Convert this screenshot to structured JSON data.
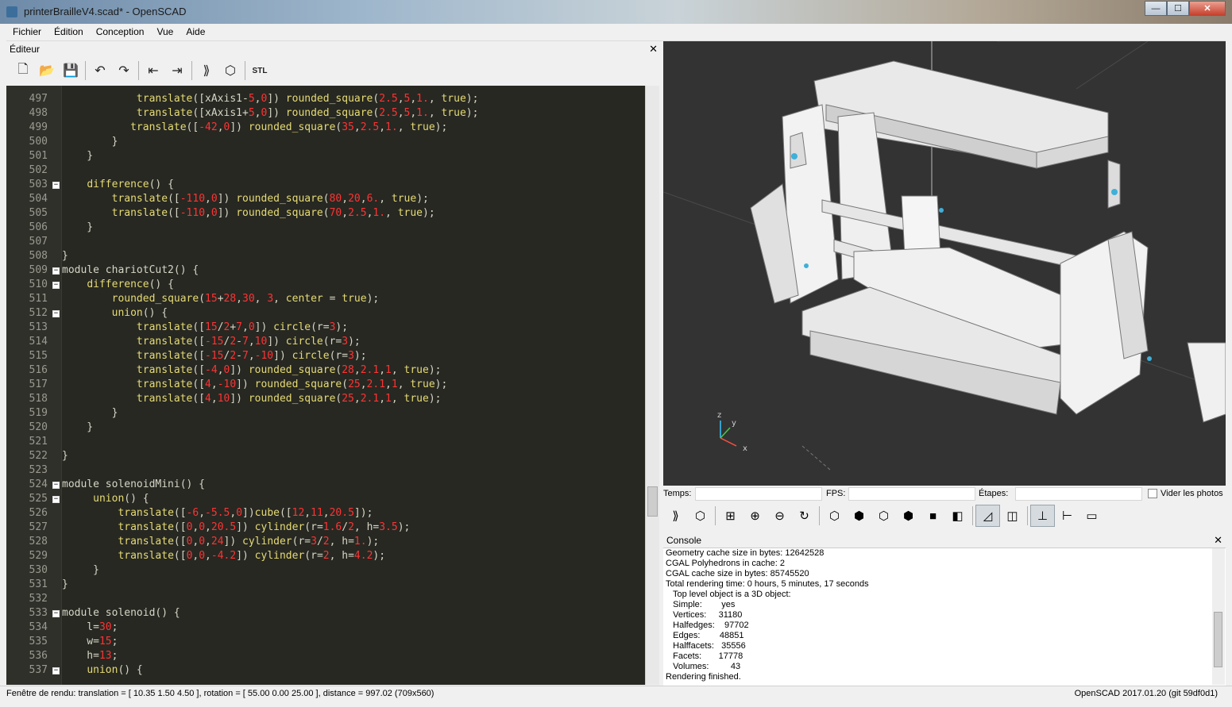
{
  "window": {
    "title": "printerBrailleV4.scad* - OpenSCAD",
    "min": "—",
    "max": "☐",
    "close": "✕"
  },
  "menu": [
    "Fichier",
    "Édition",
    "Conception",
    "Vue",
    "Aide"
  ],
  "editor": {
    "title": "Éditeur",
    "close": "✕",
    "toolbar": [
      {
        "name": "new-file-icon",
        "glyph": "🗋"
      },
      {
        "name": "open-file-icon",
        "glyph": "📂"
      },
      {
        "name": "save-icon",
        "glyph": "💾"
      },
      {
        "name": "undo-icon",
        "glyph": "↶"
      },
      {
        "name": "redo-icon",
        "glyph": "↷"
      },
      {
        "name": "unindent-icon",
        "glyph": "⇤"
      },
      {
        "name": "indent-icon",
        "glyph": "⇥"
      },
      {
        "name": "preview-icon",
        "glyph": "⟫"
      },
      {
        "name": "render-icon",
        "glyph": "⬡"
      },
      {
        "name": "export-stl-icon",
        "glyph": "STL"
      }
    ],
    "lines": [
      {
        "n": "497",
        "fold": "",
        "code": "            translate([xAxis1-5,0]) rounded_square(2.5,5,1., true);"
      },
      {
        "n": "498",
        "fold": "",
        "code": "            translate([xAxis1+5,0]) rounded_square(2.5,5,1., true);"
      },
      {
        "n": "499",
        "fold": "",
        "code": "           translate([-42,0]) rounded_square(35,2.5,1., true);"
      },
      {
        "n": "500",
        "fold": "",
        "code": "        }"
      },
      {
        "n": "501",
        "fold": "",
        "code": "    }"
      },
      {
        "n": "502",
        "fold": "",
        "code": ""
      },
      {
        "n": "503",
        "fold": "−",
        "code": "    difference() {"
      },
      {
        "n": "504",
        "fold": "",
        "code": "        translate([-110,0]) rounded_square(80,20,6., true);"
      },
      {
        "n": "505",
        "fold": "",
        "code": "        translate([-110,0]) rounded_square(70,2.5,1., true);"
      },
      {
        "n": "506",
        "fold": "",
        "code": "    }"
      },
      {
        "n": "507",
        "fold": "",
        "code": ""
      },
      {
        "n": "508",
        "fold": "",
        "code": "}"
      },
      {
        "n": "509",
        "fold": "−",
        "code": "module chariotCut2() {"
      },
      {
        "n": "510",
        "fold": "−",
        "code": "    difference() {"
      },
      {
        "n": "511",
        "fold": "",
        "code": "        rounded_square(15+28,30, 3, center = true);"
      },
      {
        "n": "512",
        "fold": "−",
        "code": "        union() {"
      },
      {
        "n": "513",
        "fold": "",
        "code": "            translate([15/2+7,0]) circle(r=3);"
      },
      {
        "n": "514",
        "fold": "",
        "code": "            translate([-15/2-7,10]) circle(r=3);"
      },
      {
        "n": "515",
        "fold": "",
        "code": "            translate([-15/2-7,-10]) circle(r=3);"
      },
      {
        "n": "516",
        "fold": "",
        "code": "            translate([-4,0]) rounded_square(28,2.1,1, true);"
      },
      {
        "n": "517",
        "fold": "",
        "code": "            translate([4,-10]) rounded_square(25,2.1,1, true);"
      },
      {
        "n": "518",
        "fold": "",
        "code": "            translate([4,10]) rounded_square(25,2.1,1, true);"
      },
      {
        "n": "519",
        "fold": "",
        "code": "        }"
      },
      {
        "n": "520",
        "fold": "",
        "code": "    }"
      },
      {
        "n": "521",
        "fold": "",
        "code": ""
      },
      {
        "n": "522",
        "fold": "",
        "code": "}"
      },
      {
        "n": "523",
        "fold": "",
        "code": ""
      },
      {
        "n": "524",
        "fold": "−",
        "code": "module solenoidMini() {"
      },
      {
        "n": "525",
        "fold": "−",
        "code": "     union() {"
      },
      {
        "n": "526",
        "fold": "",
        "code": "         translate([-6,-5.5,0])cube([12,11,20.5]);"
      },
      {
        "n": "527",
        "fold": "",
        "code": "         translate([0,0,20.5]) cylinder(r=1.6/2, h=3.5);"
      },
      {
        "n": "528",
        "fold": "",
        "code": "         translate([0,0,24]) cylinder(r=3/2, h=1.);"
      },
      {
        "n": "529",
        "fold": "",
        "code": "         translate([0,0,-4.2]) cylinder(r=2, h=4.2);"
      },
      {
        "n": "530",
        "fold": "",
        "code": "     }"
      },
      {
        "n": "531",
        "fold": "",
        "code": "}"
      },
      {
        "n": "532",
        "fold": "",
        "code": ""
      },
      {
        "n": "533",
        "fold": "−",
        "code": "module solenoid() {"
      },
      {
        "n": "534",
        "fold": "",
        "code": "    l=30;"
      },
      {
        "n": "535",
        "fold": "",
        "code": "    w=15;"
      },
      {
        "n": "536",
        "fold": "",
        "code": "    h=13;"
      },
      {
        "n": "537",
        "fold": "−",
        "code": "    union() {"
      }
    ]
  },
  "viewer": {
    "axis": {
      "x": "x",
      "y": "y",
      "z": "z"
    },
    "colors": {
      "background": "#333333",
      "model": "#f2f2f2",
      "model_shade": "#bdbdbd",
      "accent": "#3fb0d8"
    }
  },
  "viewer_toolbar": {
    "temps_label": "Temps:",
    "fps_label": "FPS:",
    "etapes_label": "Étapes:",
    "vider_label": "Vider les photos",
    "tools": [
      {
        "name": "preview-icon",
        "glyph": "⟫",
        "on": false
      },
      {
        "name": "render-icon",
        "glyph": "⬡",
        "on": false
      },
      {
        "name": "view-all-icon",
        "glyph": "⊞",
        "on": false
      },
      {
        "name": "zoom-in-icon",
        "glyph": "⊕",
        "on": false
      },
      {
        "name": "zoom-out-icon",
        "glyph": "⊖",
        "on": false
      },
      {
        "name": "reset-view-icon",
        "glyph": "↻",
        "on": false
      },
      {
        "name": "view-right-icon",
        "glyph": "⬡",
        "on": false
      },
      {
        "name": "view-top-icon",
        "glyph": "⬢",
        "on": false
      },
      {
        "name": "view-bottom-icon",
        "glyph": "⬡",
        "on": false
      },
      {
        "name": "view-left-icon",
        "glyph": "⬢",
        "on": false
      },
      {
        "name": "view-front-icon",
        "glyph": "■",
        "on": false
      },
      {
        "name": "view-back-icon",
        "glyph": "◧",
        "on": false
      },
      {
        "name": "perspective-icon",
        "glyph": "◿",
        "on": true
      },
      {
        "name": "orthogonal-icon",
        "glyph": "◫",
        "on": false
      },
      {
        "name": "show-axes-icon",
        "glyph": "⊥",
        "on": true
      },
      {
        "name": "show-scale-icon",
        "glyph": "⊢",
        "on": false
      },
      {
        "name": "show-edges-icon",
        "glyph": "▭",
        "on": false
      }
    ]
  },
  "console": {
    "title": "Console",
    "close": "✕",
    "lines": [
      "Geometry cache size in bytes: 12642528",
      "CGAL Polyhedrons in cache: 2",
      "CGAL cache size in bytes: 85745520",
      "Total rendering time: 0 hours, 5 minutes, 17 seconds",
      "   Top level object is a 3D object:",
      "   Simple:        yes",
      "   Vertices:     31180",
      "   Halfedges:    97702",
      "   Edges:        48851",
      "   Halffacets:   35556",
      "   Facets:       17778",
      "   Volumes:         43",
      "Rendering finished."
    ]
  },
  "status": {
    "left": "Fenêtre de rendu: translation = [ 10.35 1.50 4.50 ], rotation = [ 55.00 0.00 25.00 ], distance = 997.02 (709x560)",
    "right": "OpenSCAD 2017.01.20 (git 59df0d1)"
  }
}
